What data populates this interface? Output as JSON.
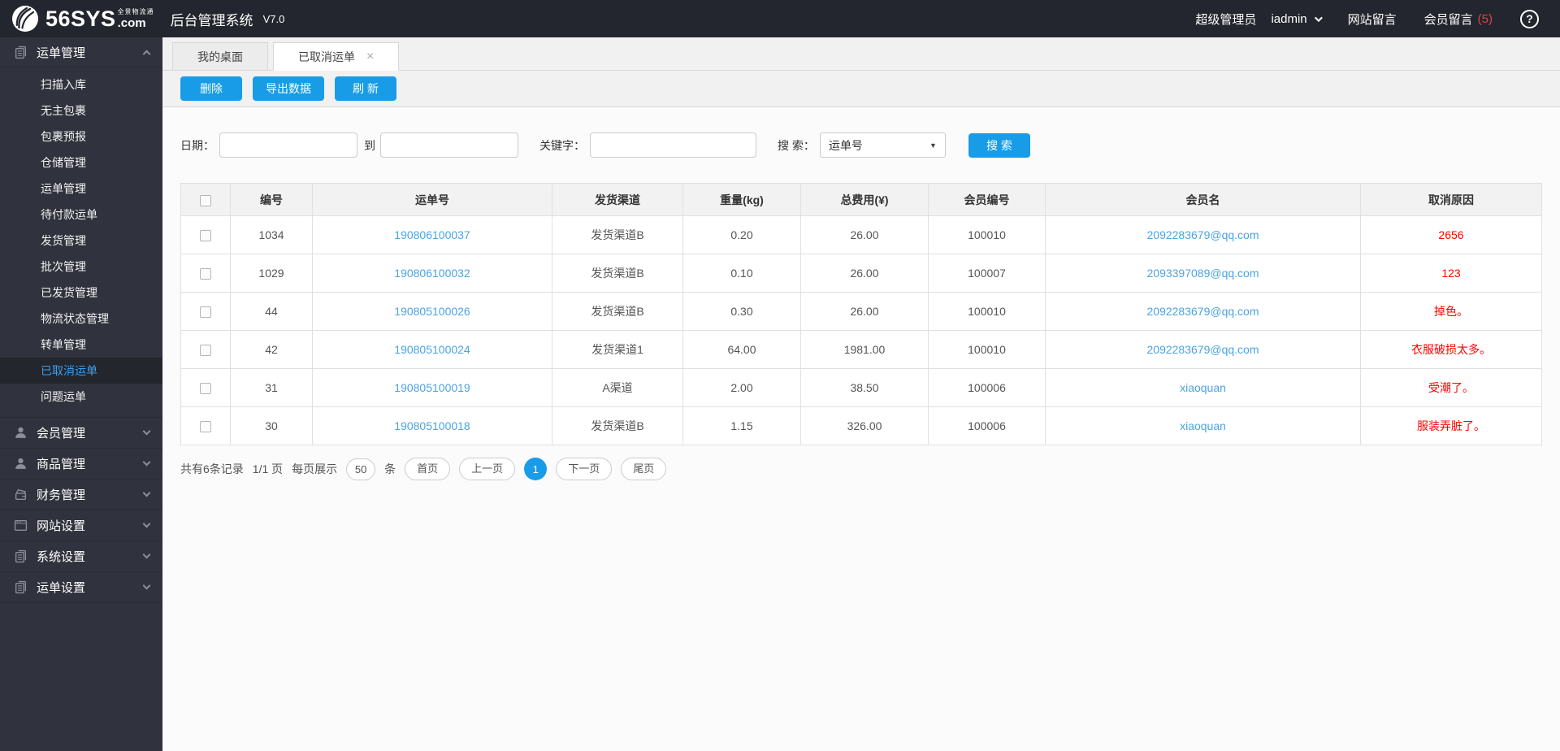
{
  "topbar": {
    "brand": "56SYS",
    "brand_tld": ".com",
    "brand_tagline": "全景物流通",
    "app_title": "后台管理系统",
    "version": "V7.0",
    "role": "超级管理员",
    "username": "iadmin",
    "site_messages": "网站留言",
    "member_messages": "会员留言",
    "member_messages_count": "(5)"
  },
  "sidebar": {
    "sections": [
      {
        "key": "waybill",
        "icon": "waybill-icon",
        "label": "运单管理",
        "expanded": true,
        "active_item": "已取消运单",
        "items": [
          "扫描入库",
          "无主包裹",
          "包裹预报",
          "仓储管理",
          "运单管理",
          "待付款运单",
          "发货管理",
          "批次管理",
          "已发货管理",
          "物流状态管理",
          "转单管理",
          "已取消运单",
          "问题运单"
        ]
      },
      {
        "key": "member",
        "icon": "member-icon",
        "label": "会员管理",
        "expanded": false
      },
      {
        "key": "goods",
        "icon": "goods-icon",
        "label": "商品管理",
        "expanded": false
      },
      {
        "key": "finance",
        "icon": "finance-icon",
        "label": "财务管理",
        "expanded": false
      },
      {
        "key": "website",
        "icon": "website-icon",
        "label": "网站设置",
        "expanded": false
      },
      {
        "key": "system",
        "icon": "system-icon",
        "label": "系统设置",
        "expanded": false
      },
      {
        "key": "waybill-settings",
        "icon": "waybill-settings-icon",
        "label": "运单设置",
        "expanded": false
      }
    ]
  },
  "tabs": [
    {
      "label": "我的桌面",
      "active": false
    },
    {
      "label": "已取消运单",
      "active": true,
      "closable": true
    }
  ],
  "toolbar": {
    "delete": "删除",
    "export": "导出数据",
    "refresh": "刷 新"
  },
  "filters": {
    "date_label": "日期：",
    "to_label": "到",
    "keyword_label": "关键字：",
    "search_label": "搜 索：",
    "search_type_selected": "运单号",
    "search_button": "搜 索"
  },
  "table": {
    "headers": [
      "编号",
      "运单号",
      "发货渠道",
      "重量(kg)",
      "总费用(¥)",
      "会员编号",
      "会员名",
      "取消原因"
    ],
    "rows": [
      {
        "id": "1034",
        "waybill_no": "190806100037",
        "channel": "发货渠道B",
        "weight": "0.20",
        "total_fee": "26.00",
        "member_id": "100010",
        "member_name": "2092283679@qq.com",
        "cancel_reason": "2656"
      },
      {
        "id": "1029",
        "waybill_no": "190806100032",
        "channel": "发货渠道B",
        "weight": "0.10",
        "total_fee": "26.00",
        "member_id": "100007",
        "member_name": "2093397089@qq.com",
        "cancel_reason": "123"
      },
      {
        "id": "44",
        "waybill_no": "190805100026",
        "channel": "发货渠道B",
        "weight": "0.30",
        "total_fee": "26.00",
        "member_id": "100010",
        "member_name": "2092283679@qq.com",
        "cancel_reason": "掉色。"
      },
      {
        "id": "42",
        "waybill_no": "190805100024",
        "channel": "发货渠道1",
        "weight": "64.00",
        "total_fee": "1981.00",
        "member_id": "100010",
        "member_name": "2092283679@qq.com",
        "cancel_reason": "衣服破损太多。"
      },
      {
        "id": "31",
        "waybill_no": "190805100019",
        "channel": "A渠道",
        "weight": "2.00",
        "total_fee": "38.50",
        "member_id": "100006",
        "member_name": "xiaoquan",
        "cancel_reason": "受潮了。"
      },
      {
        "id": "30",
        "waybill_no": "190805100018",
        "channel": "发货渠道B",
        "weight": "1.15",
        "total_fee": "326.00",
        "member_id": "100006",
        "member_name": "xiaoquan",
        "cancel_reason": "服装弄脏了。"
      }
    ]
  },
  "pagination": {
    "summary": "共有6条记录",
    "page_info": "1/1 页",
    "per_page_label": "每页展示",
    "per_page_value": "50",
    "per_page_unit": "条",
    "first": "首页",
    "prev": "上一页",
    "current": "1",
    "next": "下一页",
    "last": "尾页"
  },
  "colors": {
    "primary": "#189ce8",
    "link": "#4ba4e2",
    "danger": "#ff0000",
    "message_count": "#e04444",
    "sidebar_active_text": "#3aa0f2",
    "topbar_bg": "#23262e",
    "sidebar_bg": "#30333d"
  }
}
